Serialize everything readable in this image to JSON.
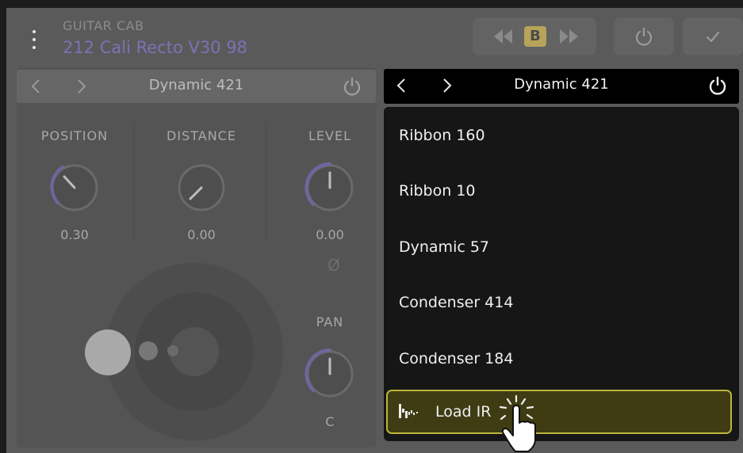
{
  "header": {
    "category": "GUITAR CAB",
    "preset_name": "212 Cali Recto V30 98",
    "ab_label": "B"
  },
  "left_panel": {
    "mic_name": "Dynamic 421",
    "knobs": [
      {
        "label": "POSITION",
        "value": "0.30"
      },
      {
        "label": "DISTANCE",
        "value": "0.00"
      },
      {
        "label": "LEVEL",
        "value": "0.00"
      }
    ],
    "phase_symbol": "Ø",
    "pan": {
      "label": "PAN",
      "value": "C"
    }
  },
  "right_panel": {
    "mic_name": "Dynamic 421",
    "options": [
      "Ribbon 160",
      "Ribbon 10",
      "Dynamic 57",
      "Condenser 414",
      "Condenser 184"
    ],
    "load_ir_label": "Load IR"
  },
  "colors": {
    "accent_purple": "#7c72b6",
    "highlight_yellow": "#bcb53c"
  },
  "icons": [
    "menu-dots-icon",
    "rewind-icon",
    "fast-forward-icon",
    "power-icon",
    "checkmark-icon",
    "chevron-left-icon",
    "chevron-right-icon",
    "impulse-response-icon",
    "hand-pointer-icon"
  ]
}
